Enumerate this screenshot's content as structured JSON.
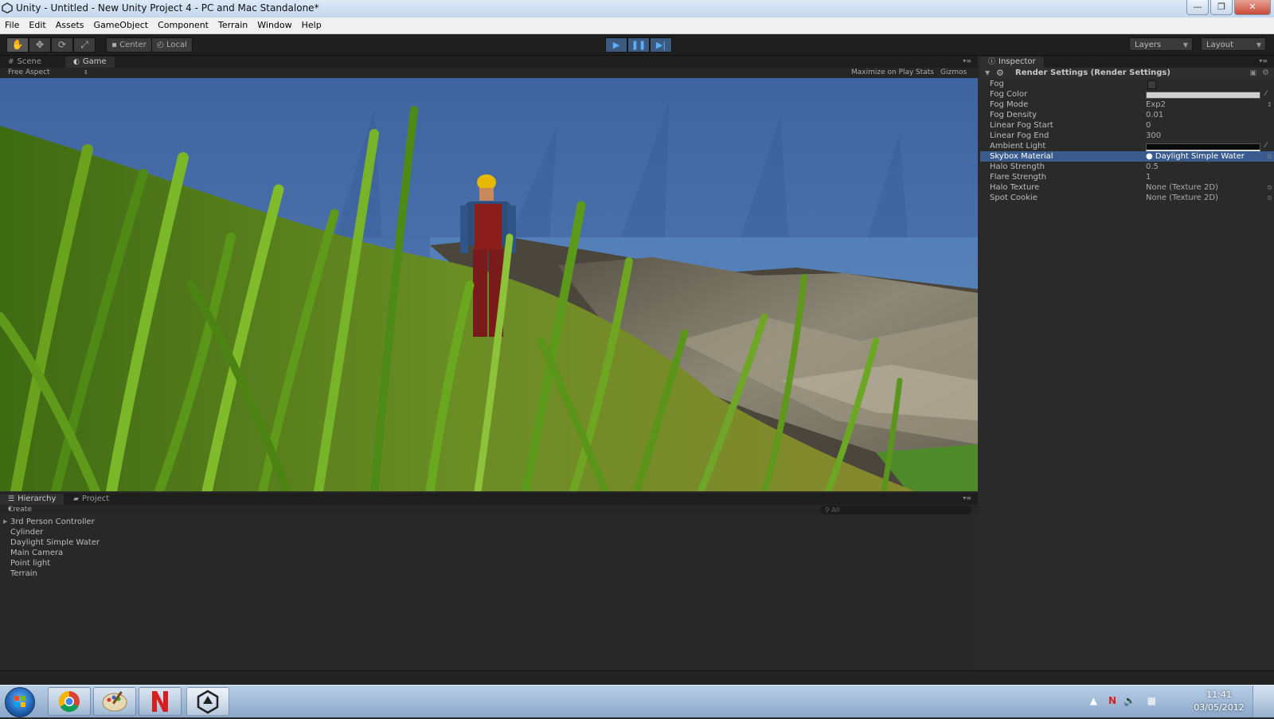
{
  "window": {
    "title": "Unity - Untitled - New Unity Project 4 - PC and Mac Standalone*",
    "minimize": "—",
    "maximize": "❐",
    "close": "✕"
  },
  "menu": [
    "File",
    "Edit",
    "Assets",
    "GameObject",
    "Component",
    "Terrain",
    "Window",
    "Help"
  ],
  "toolbar": {
    "pivot_label": "Center",
    "space_label": "Local",
    "layers_label": "Layers",
    "layout_label": "Layout"
  },
  "game_panel": {
    "tabs": [
      "Scene",
      "Game"
    ],
    "aspect_label": "Free Aspect",
    "maximize_label": "Maximize on Play",
    "stats_label": "Stats",
    "gizmos_label": "Gizmos"
  },
  "hierarchy": {
    "tabs": [
      "Hierarchy",
      "Project"
    ],
    "create_label": "Create",
    "search_placeholder": "All",
    "items": [
      "3rd Person Controller",
      "Cylinder",
      "Daylight Simple Water",
      "Main Camera",
      "Point light",
      "Terrain"
    ]
  },
  "inspector": {
    "tab": "Inspector",
    "component_title": "Render Settings (Render Settings)",
    "properties": [
      {
        "label": "Fog",
        "value": ""
      },
      {
        "label": "Fog Color",
        "value": ""
      },
      {
        "label": "Fog Mode",
        "value": "Exp2"
      },
      {
        "label": "Fog Density",
        "value": "0.01"
      },
      {
        "label": "Linear Fog Start",
        "value": "0"
      },
      {
        "label": "Linear Fog End",
        "value": "300"
      },
      {
        "label": "Ambient Light",
        "value": ""
      },
      {
        "label": "Skybox Material",
        "value": "Daylight Simple Water"
      },
      {
        "label": "Halo Strength",
        "value": "0.5"
      },
      {
        "label": "Flare Strength",
        "value": "1"
      },
      {
        "label": "Halo Texture",
        "value": "None (Texture 2D)"
      },
      {
        "label": "Spot Cookie",
        "value": "None (Texture 2D)"
      }
    ]
  },
  "taskbar": {
    "time": "11:41",
    "date": "03/05/2012"
  },
  "colors": {
    "sky": "#4a6da3",
    "grass": "#5d8f1e",
    "selection": "#3a5b8c",
    "panel": "#2a2a2a"
  }
}
